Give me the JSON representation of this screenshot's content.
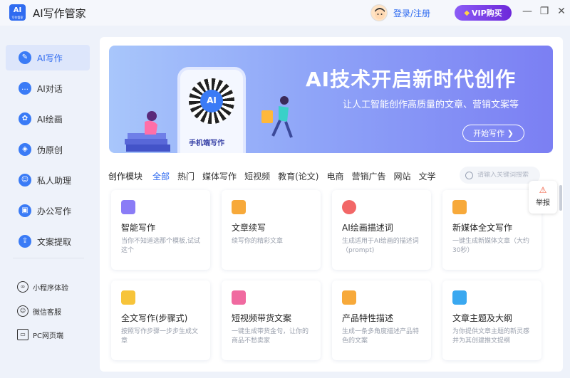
{
  "window": {
    "app_title": "AI写作管家",
    "logo_text": "AI",
    "logo_sub": "写作管家",
    "login_label": "登录/注册",
    "vip_label": "VIP购买",
    "minimize": "—",
    "restore": "❐",
    "close": "✕"
  },
  "sidebar": {
    "items": [
      {
        "label": "AI写作",
        "icon": "✎",
        "active": true
      },
      {
        "label": "AI对话",
        "icon": "…"
      },
      {
        "label": "AI绘画",
        "icon": "✿"
      },
      {
        "label": "伪原创",
        "icon": "◈"
      },
      {
        "label": "私人助理",
        "icon": "☺"
      },
      {
        "label": "办公写作",
        "icon": "▣"
      },
      {
        "label": "文案提取",
        "icon": "⇪"
      }
    ],
    "utilities": [
      {
        "label": "小程序体验",
        "icon": "∞"
      },
      {
        "label": "微信客服",
        "icon": "☺"
      },
      {
        "label": "PC网页端",
        "icon": "▭"
      }
    ]
  },
  "banner": {
    "title": "AI技术开启新时代创作",
    "subtitle": "让人工智能创作高质量的文章、营销文案等",
    "cta": "开始写作 ❯",
    "phone_label": "手机端写作",
    "qr_text": "AI"
  },
  "categories": {
    "label": "创作模块",
    "tabs": [
      "全部",
      "热门",
      "媒体写作",
      "短视频",
      "教育(论文)",
      "电商",
      "营销广告",
      "网站",
      "文学"
    ],
    "active_index": 0,
    "search_placeholder": "请输入关键词搜索"
  },
  "cards": [
    {
      "title": "智能写作",
      "desc": "当你不知道选那个模板,试试这个",
      "color": "#8a7cf6"
    },
    {
      "title": "文章续写",
      "desc": "续写你的精彩文章",
      "color": "#f7a93a"
    },
    {
      "title": "AI绘画描述词",
      "desc": "生成适用于AI绘画的描述词（prompt)",
      "color": "#f26767"
    },
    {
      "title": "新媒体全文写作",
      "desc": "一键生成新媒体文章（大约30秒）",
      "color": "#f7a93a"
    },
    {
      "title": "全文写作(步骤式)",
      "desc": "按照写作步骤一步步生成文章",
      "color": "#f7c43a"
    },
    {
      "title": "短视频带货文案",
      "desc": "一键生成带货金句，让你的商品不愁卖家",
      "color": "#f06aa0"
    },
    {
      "title": "产品特性描述",
      "desc": "生成一条多角度描述产品特色的文案",
      "color": "#f7a93a"
    },
    {
      "title": "文章主题及大纲",
      "desc": "为你提供文章主题的新灵感 并为其创建推文提纲",
      "color": "#3aa8f0"
    }
  ],
  "report": {
    "label": "举报",
    "icon": "⚠"
  }
}
